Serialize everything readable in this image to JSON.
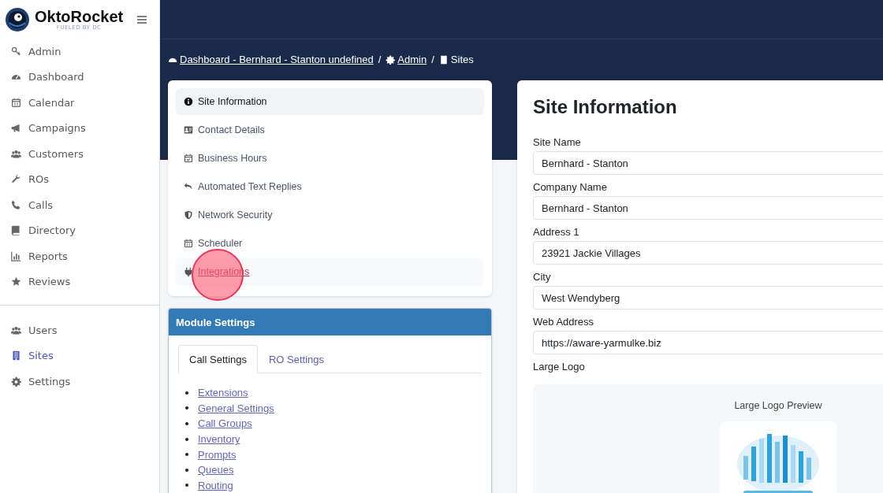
{
  "sidebar": {
    "logo": {
      "name": "OktoRocket",
      "tagline": "FUELED BY DC"
    },
    "sections": [
      {
        "items": [
          {
            "label": "Admin",
            "selected": false
          },
          {
            "label": "Dashboard",
            "selected": false
          },
          {
            "label": "Calendar",
            "selected": false
          },
          {
            "label": "Campaigns",
            "selected": false
          },
          {
            "label": "Customers",
            "selected": false
          },
          {
            "label": "ROs",
            "selected": false
          },
          {
            "label": "Calls",
            "selected": false
          },
          {
            "label": "Directory",
            "selected": false
          },
          {
            "label": "Reports",
            "selected": false
          },
          {
            "label": "Reviews",
            "selected": false
          }
        ]
      },
      {
        "items": [
          {
            "label": "Users",
            "selected": false
          },
          {
            "label": "Sites",
            "selected": true
          },
          {
            "label": "Settings",
            "selected": false
          }
        ]
      }
    ]
  },
  "breadcrumb": {
    "separator": "/",
    "items": [
      {
        "label": "Dashboard - Bernhard - Stanton undefined",
        "link": true
      },
      {
        "label": "Admin",
        "link": true
      },
      {
        "label": "Sites",
        "link": false
      }
    ]
  },
  "site_nav": [
    {
      "label": "Site Information",
      "selected": true,
      "hovered": false
    },
    {
      "label": "Contact Details",
      "selected": false,
      "hovered": false
    },
    {
      "label": "Business Hours",
      "selected": false,
      "hovered": false
    },
    {
      "label": "Automated Text Replies",
      "selected": false,
      "hovered": false
    },
    {
      "label": "Network Security",
      "selected": false,
      "hovered": false
    },
    {
      "label": "Scheduler",
      "selected": false,
      "hovered": false
    },
    {
      "label": "Integrations",
      "selected": false,
      "hovered": true
    }
  ],
  "module_settings": {
    "title": "Module Settings",
    "tabs": [
      {
        "label": "Call Settings",
        "selected": true
      },
      {
        "label": "RO Settings",
        "selected": false
      }
    ],
    "links": [
      "Extensions",
      "General Settings",
      "Call Groups",
      "Inventory",
      "Prompts",
      "Queues",
      "Routing"
    ]
  },
  "site_information": {
    "title": "Site Information",
    "fields": [
      {
        "label": "Site Name",
        "value": "Bernhard - Stanton"
      },
      {
        "label": "Company Name",
        "value": "Bernhard - Stanton"
      },
      {
        "label": "Address 1",
        "value": "23921 Jackie Villages"
      },
      {
        "label": "City",
        "value": "West Wendyberg"
      },
      {
        "label": "Web Address",
        "value": "https://aware-yarmulke.biz"
      }
    ],
    "large_logo": {
      "label": "Large Logo",
      "preview_label": "Large Logo Preview"
    }
  }
}
